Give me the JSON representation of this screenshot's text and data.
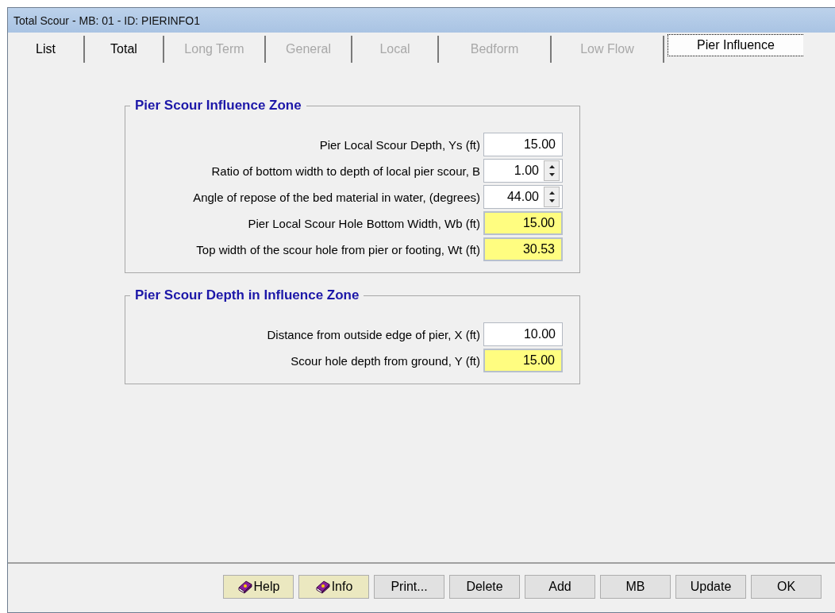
{
  "window": {
    "title": "Total Scour - MB: 01 - ID: PIERINFO1"
  },
  "tabs": [
    {
      "label": "List",
      "selected": false,
      "disabled": false
    },
    {
      "label": "Total",
      "selected": false,
      "disabled": false
    },
    {
      "label": "Long Term",
      "selected": false,
      "disabled": true
    },
    {
      "label": "General",
      "selected": false,
      "disabled": true
    },
    {
      "label": "Local",
      "selected": false,
      "disabled": true
    },
    {
      "label": "Bedform",
      "selected": false,
      "disabled": true
    },
    {
      "label": "Low Flow",
      "selected": false,
      "disabled": true
    },
    {
      "label": "Pier Influence",
      "selected": true,
      "disabled": false
    }
  ],
  "groups": [
    {
      "title": "Pier Scour Influence Zone",
      "fields": [
        {
          "label": "Pier Local Scour Depth, Ys (ft)",
          "value": "15.00",
          "kind": "input"
        },
        {
          "label": "Ratio of bottom width to depth of local pier scour, B",
          "value": "1.00",
          "kind": "spinner"
        },
        {
          "label": "Angle of repose of the bed material in water, (degrees)",
          "value": "44.00",
          "kind": "spinner"
        },
        {
          "label": "Pier Local Scour Hole Bottom Width, Wb (ft)",
          "value": "15.00",
          "kind": "computed"
        },
        {
          "label": "Top width of the scour hole from pier or footing, Wt (ft)",
          "value": "30.53",
          "kind": "computed"
        }
      ]
    },
    {
      "title": "Pier Scour Depth in Influence Zone",
      "fields": [
        {
          "label": "Distance from outside edge of pier, X (ft)",
          "value": "10.00",
          "kind": "input"
        },
        {
          "label": "Scour hole depth from ground, Y (ft)",
          "value": "15.00",
          "kind": "computed"
        }
      ]
    }
  ],
  "buttons": [
    {
      "label": "Help",
      "kind": "help"
    },
    {
      "label": "Info",
      "kind": "help"
    },
    {
      "label": "Print...",
      "kind": "plain"
    },
    {
      "label": "Delete",
      "kind": "plain"
    },
    {
      "label": "Add",
      "kind": "plain"
    },
    {
      "label": "MB",
      "kind": "plain"
    },
    {
      "label": "Update",
      "kind": "plain"
    },
    {
      "label": "OK",
      "kind": "plain"
    }
  ]
}
